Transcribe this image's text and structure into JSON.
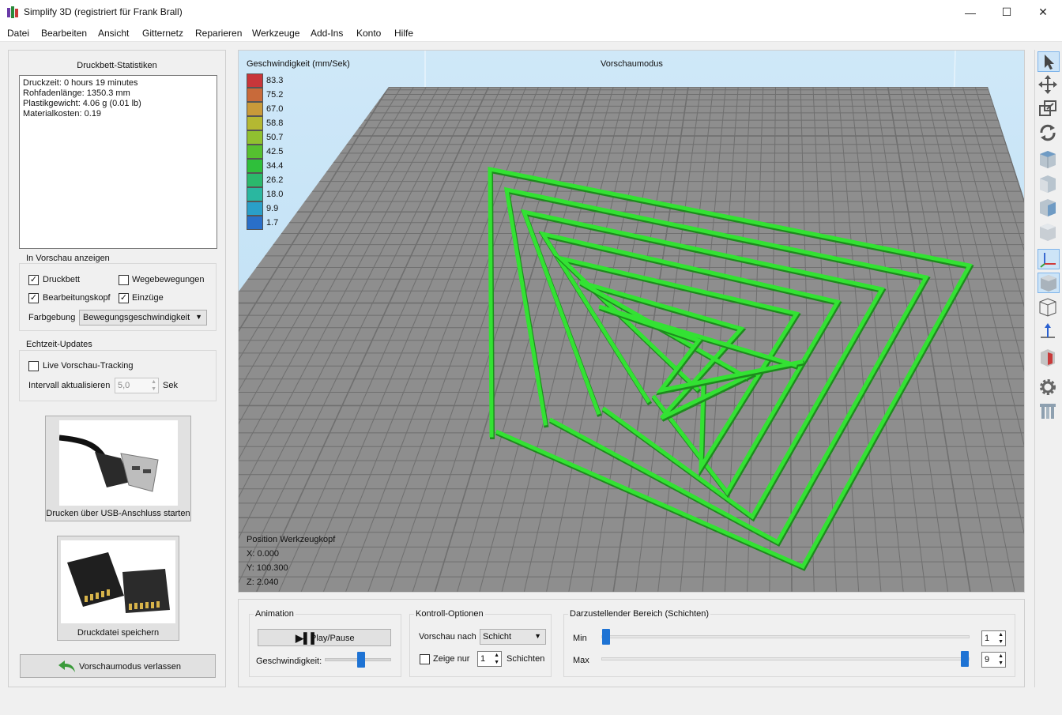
{
  "window": {
    "title": "Simplify 3D (registriert für Frank Brall)",
    "minimize": "—",
    "maximize": "☐",
    "close": "✕"
  },
  "menu": [
    "Datei",
    "Bearbeiten",
    "Ansicht",
    "Gitternetz",
    "Reparieren",
    "Werkzeuge",
    "Add-Ins",
    "Konto",
    "Hilfe"
  ],
  "stats": {
    "heading": "Druckbett-Statistiken",
    "lines": [
      "Druckzeit: 0 hours 19 minutes",
      "Rohfadenlänge: 1350.3 mm",
      "Plastikgewicht: 4.06 g (0.01 lb)",
      "Materialkosten: 0.19"
    ]
  },
  "preview_group": {
    "label": "In Vorschau anzeigen",
    "checks": [
      {
        "label": "Druckbett",
        "checked": true
      },
      {
        "label": "Wegebewegungen",
        "checked": false
      },
      {
        "label": "Bearbeitungskopf",
        "checked": true
      },
      {
        "label": "Einzüge",
        "checked": true
      }
    ],
    "color_label": "Farbgebung",
    "color_value": "Bewegungsgeschwindigkeit"
  },
  "realtime": {
    "label": "Echtzeit-Updates",
    "live_label": "Live Vorschau-Tracking",
    "live_checked": false,
    "interval_label": "Intervall aktualisieren",
    "interval_value": "5,0",
    "unit": "Sek"
  },
  "usb_button": "Drucken über USB-Anschluss starten",
  "sd_button": "Druckdatei speichern",
  "exit_button": "Vorschaumodus verlassen",
  "viewport": {
    "mode": "Vorschaumodus",
    "legend_title": "Geschwindigkeit (mm/Sek)",
    "legend": [
      {
        "value": "83.3",
        "color": "#c8363a"
      },
      {
        "value": "75.2",
        "color": "#c86a3a"
      },
      {
        "value": "67.0",
        "color": "#c89a3a"
      },
      {
        "value": "58.8",
        "color": "#b4b832"
      },
      {
        "value": "50.7",
        "color": "#90c030"
      },
      {
        "value": "42.5",
        "color": "#55c030"
      },
      {
        "value": "34.4",
        "color": "#2fbf3b"
      },
      {
        "value": "26.2",
        "color": "#2bb86c"
      },
      {
        "value": "18.0",
        "color": "#2ab7a0"
      },
      {
        "value": "9.9",
        "color": "#2a9fc8"
      },
      {
        "value": "1.7",
        "color": "#2a6fc8"
      }
    ],
    "position_title": "Position Werkzeugkopf",
    "x": "X: 0.000",
    "y": "Y: 100.300",
    "z": "Z: 2.040"
  },
  "animation": {
    "label": "Animation",
    "play": "Play/Pause",
    "speed_label": "Geschwindigkeit:",
    "speed_level": 0.55
  },
  "controls": {
    "label": "Kontroll-Optionen",
    "preview_by": "Vorschau nach",
    "preview_value": "Schicht",
    "show_only": "Zeige nur",
    "show_only_checked": false,
    "count": "1",
    "layers": "Schichten"
  },
  "range": {
    "label": "Darzustellender Bereich (Schichten)",
    "min_label": "Min",
    "max_label": "Max",
    "min_value": "1",
    "max_value": "9",
    "min_level": 0.0,
    "max_level": 1.0
  },
  "toolbar": [
    "select-arrow-icon",
    "move-icon",
    "scale-icon",
    "rotate-icon",
    "view-iso-icon",
    "view-front-icon",
    "view-top-icon",
    "view-side-icon",
    "axes-icon",
    "solid-cube-icon",
    "wireframe-cube-icon",
    "normals-icon",
    "cross-section-icon",
    "settings-gear-icon",
    "supports-icon"
  ]
}
